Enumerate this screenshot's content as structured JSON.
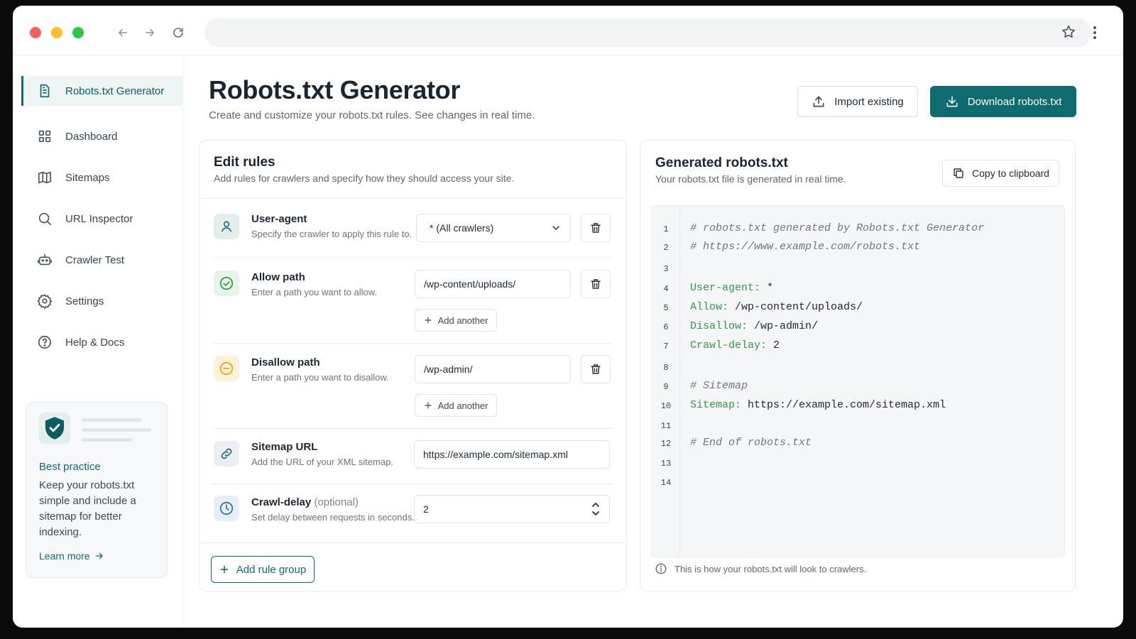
{
  "sidebar": {
    "items": [
      {
        "label": "Robots.txt Generator",
        "icon": "file-text-icon",
        "active": true
      },
      {
        "label": "Dashboard",
        "icon": "grid-icon"
      },
      {
        "label": "Sitemaps",
        "icon": "map-icon"
      },
      {
        "label": "URL Inspector",
        "icon": "search-icon"
      },
      {
        "label": "Crawler Test",
        "icon": "robot-icon"
      },
      {
        "label": "Settings",
        "icon": "gear-icon"
      },
      {
        "label": "Help & Docs",
        "icon": "help-circle-icon"
      }
    ],
    "tip": {
      "title": "Best practice",
      "text": "Keep your robots.txt simple and include a sitemap for better indexing.",
      "link": "Learn more"
    }
  },
  "header": {
    "title": "Robots.txt Generator",
    "subtitle": "Create and customize your robots.txt rules. See changes in real time.",
    "import_label": "Import existing",
    "download_label": "Download robots.txt"
  },
  "edit": {
    "title": "Edit rules",
    "subtitle": "Add rules for crawlers and specify how they should access your site.",
    "rules": {
      "user_agent": {
        "title": "User-agent",
        "desc": "Specify the crawler to apply this rule to.",
        "value": "* (All crawlers)"
      },
      "allow": {
        "title": "Allow path",
        "desc": "Enter a path you want to allow.",
        "value": "/wp-content/uploads/",
        "add_label": "Add another"
      },
      "disallow": {
        "title": "Disallow path",
        "desc": "Enter a path you want to disallow.",
        "value": "/wp-admin/",
        "add_label": "Add another"
      },
      "sitemap": {
        "title": "Sitemap URL",
        "desc": "Add the URL of your XML sitemap.",
        "value": "https://example.com/sitemap.xml"
      },
      "crawl_delay": {
        "title": "Crawl-delay",
        "optional": "(optional)",
        "desc": "Set delay between requests in seconds.",
        "value": "2"
      }
    },
    "add_group_label": "Add rule group"
  },
  "output": {
    "title": "Generated robots.txt",
    "subtitle": "Your robots.txt file is generated in real time.",
    "copy_label": "Copy to clipboard",
    "lines": [
      {
        "n": "1",
        "key": "",
        "val": "",
        "comment": "# robots.txt generated by Robots.txt Generator"
      },
      {
        "n": "2",
        "key": "",
        "val": "",
        "comment": "# https://www.example.com/robots.txt"
      },
      {
        "n": "3",
        "key": "",
        "val": "",
        "comment": ""
      },
      {
        "n": "4",
        "key": "User-agent:",
        "val": " *",
        "comment": ""
      },
      {
        "n": "5",
        "key": "Allow:",
        "val": " /wp-content/uploads/",
        "comment": ""
      },
      {
        "n": "6",
        "key": "Disallow:",
        "val": " /wp-admin/",
        "comment": ""
      },
      {
        "n": "7",
        "key": "Crawl-delay:",
        "val": " 2",
        "comment": ""
      },
      {
        "n": "8",
        "key": "",
        "val": "",
        "comment": ""
      },
      {
        "n": "9",
        "key": "",
        "val": "",
        "comment": "# Sitemap"
      },
      {
        "n": "10",
        "key": "Sitemap:",
        "val": " https://example.com/sitemap.xml",
        "comment": ""
      },
      {
        "n": "11",
        "key": "",
        "val": "",
        "comment": ""
      },
      {
        "n": "12",
        "key": "",
        "val": "",
        "comment": "# End of robots.txt"
      },
      {
        "n": "13",
        "key": "",
        "val": "",
        "comment": ""
      },
      {
        "n": "14",
        "key": "",
        "val": "",
        "comment": ""
      }
    ],
    "note": "This is how your robots.txt will look to crawlers."
  },
  "colors": {
    "accent": "#0e6b6e",
    "code_key": "#2f9a4a",
    "allow_icon": "#2f9a4a",
    "disallow_icon": "#e8a317"
  }
}
